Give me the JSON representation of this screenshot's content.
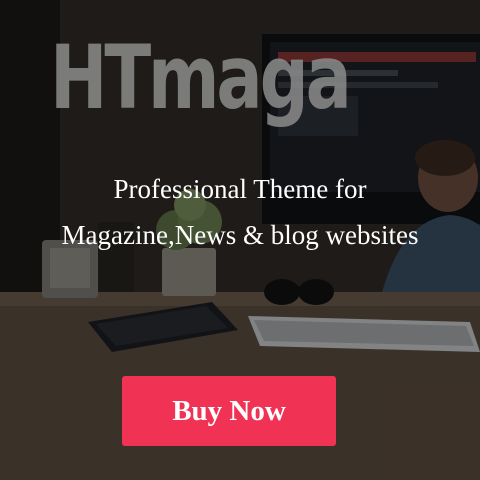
{
  "logo": {
    "text": "HTmagazine"
  },
  "tagline": {
    "line1": "Professional Theme for",
    "line2": "Magazine,News & blog websites"
  },
  "cta": {
    "label": "Buy Now",
    "color": "#f03354"
  },
  "scene": {
    "items": [
      "desk-lamp",
      "potted-plant",
      "notebook",
      "sunglasses",
      "keyboard",
      "monitor",
      "person-at-desk"
    ]
  }
}
